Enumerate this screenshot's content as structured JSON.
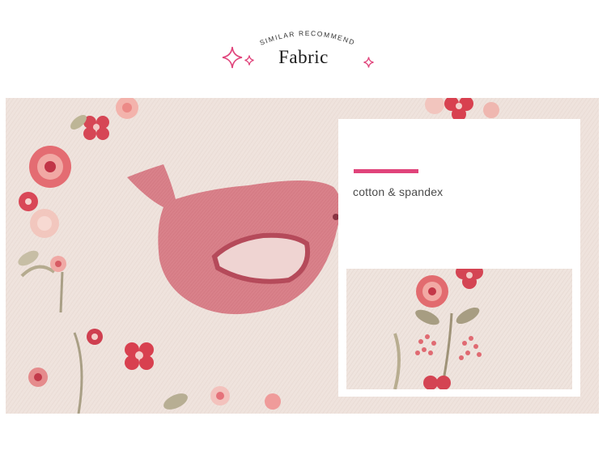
{
  "header": {
    "subtitle": "SIMILAR  RECOMMEND",
    "title": "Fabric",
    "accent_color": "#e0447b"
  },
  "main_image": {
    "subject": "pink bird and floral wreath print on beige knit fabric",
    "background_color": "#efe3dd"
  },
  "info_card": {
    "material": "cotton & spandex",
    "accent_color": "#e0447b"
  },
  "icons": [
    "sparkle-icon"
  ]
}
